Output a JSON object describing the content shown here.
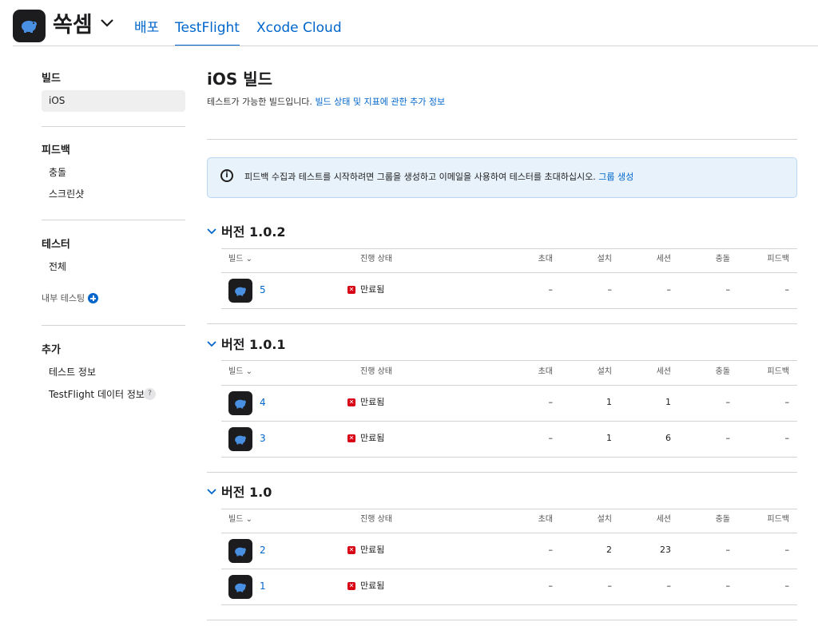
{
  "app": {
    "name": "쏙셈"
  },
  "tabs": [
    {
      "label": "배포"
    },
    {
      "label": "TestFlight"
    },
    {
      "label": "Xcode Cloud"
    }
  ],
  "sidebar": {
    "builds_header": "빌드",
    "builds_items": [
      "iOS"
    ],
    "feedback_header": "피드백",
    "feedback_items": [
      "충돌",
      "스크린샷"
    ],
    "testers_header": "테스터",
    "testers_items": [
      "전체"
    ],
    "internal_testing": "내부 테스팅",
    "extra_header": "추가",
    "extra_items": [
      "테스트 정보",
      "TestFlight 데이터 정보"
    ],
    "help_glyph": "?"
  },
  "main": {
    "title": "iOS 빌드",
    "subtitle": "테스트가 가능한 빌드입니다.",
    "subtitle_link": "빌드 상태 및 지표에 관한 추가 정보",
    "banner_icon": "i",
    "banner_text": "피드백 수집과 테스트를 시작하려면 그룹을 생성하고 이메일을 사용하여 테스터를 초대하십시오.",
    "banner_link": "그룹 생성"
  },
  "columns": {
    "build": "빌드",
    "status": "진행 상태",
    "invites": "초대",
    "installs": "설치",
    "sessions": "세션",
    "crashes": "충돌",
    "feedback": "피드백"
  },
  "status_glyph": "✕",
  "versions": [
    {
      "title": "버전 1.0.2",
      "builds": [
        {
          "number": "5",
          "status": "만료됨",
          "invites": "–",
          "installs": "–",
          "sessions": "–",
          "crashes": "–",
          "feedback": "–"
        }
      ]
    },
    {
      "title": "버전 1.0.1",
      "builds": [
        {
          "number": "4",
          "status": "만료됨",
          "invites": "–",
          "installs": "1",
          "sessions": "1",
          "crashes": "–",
          "feedback": "–"
        },
        {
          "number": "3",
          "status": "만료됨",
          "invites": "–",
          "installs": "1",
          "sessions": "6",
          "crashes": "–",
          "feedback": "–"
        }
      ]
    },
    {
      "title": "버전 1.0",
      "builds": [
        {
          "number": "2",
          "status": "만료됨",
          "invites": "–",
          "installs": "2",
          "sessions": "23",
          "crashes": "–",
          "feedback": "–"
        },
        {
          "number": "1",
          "status": "만료됨",
          "invites": "–",
          "installs": "–",
          "sessions": "–",
          "crashes": "–",
          "feedback": "–"
        }
      ]
    }
  ]
}
